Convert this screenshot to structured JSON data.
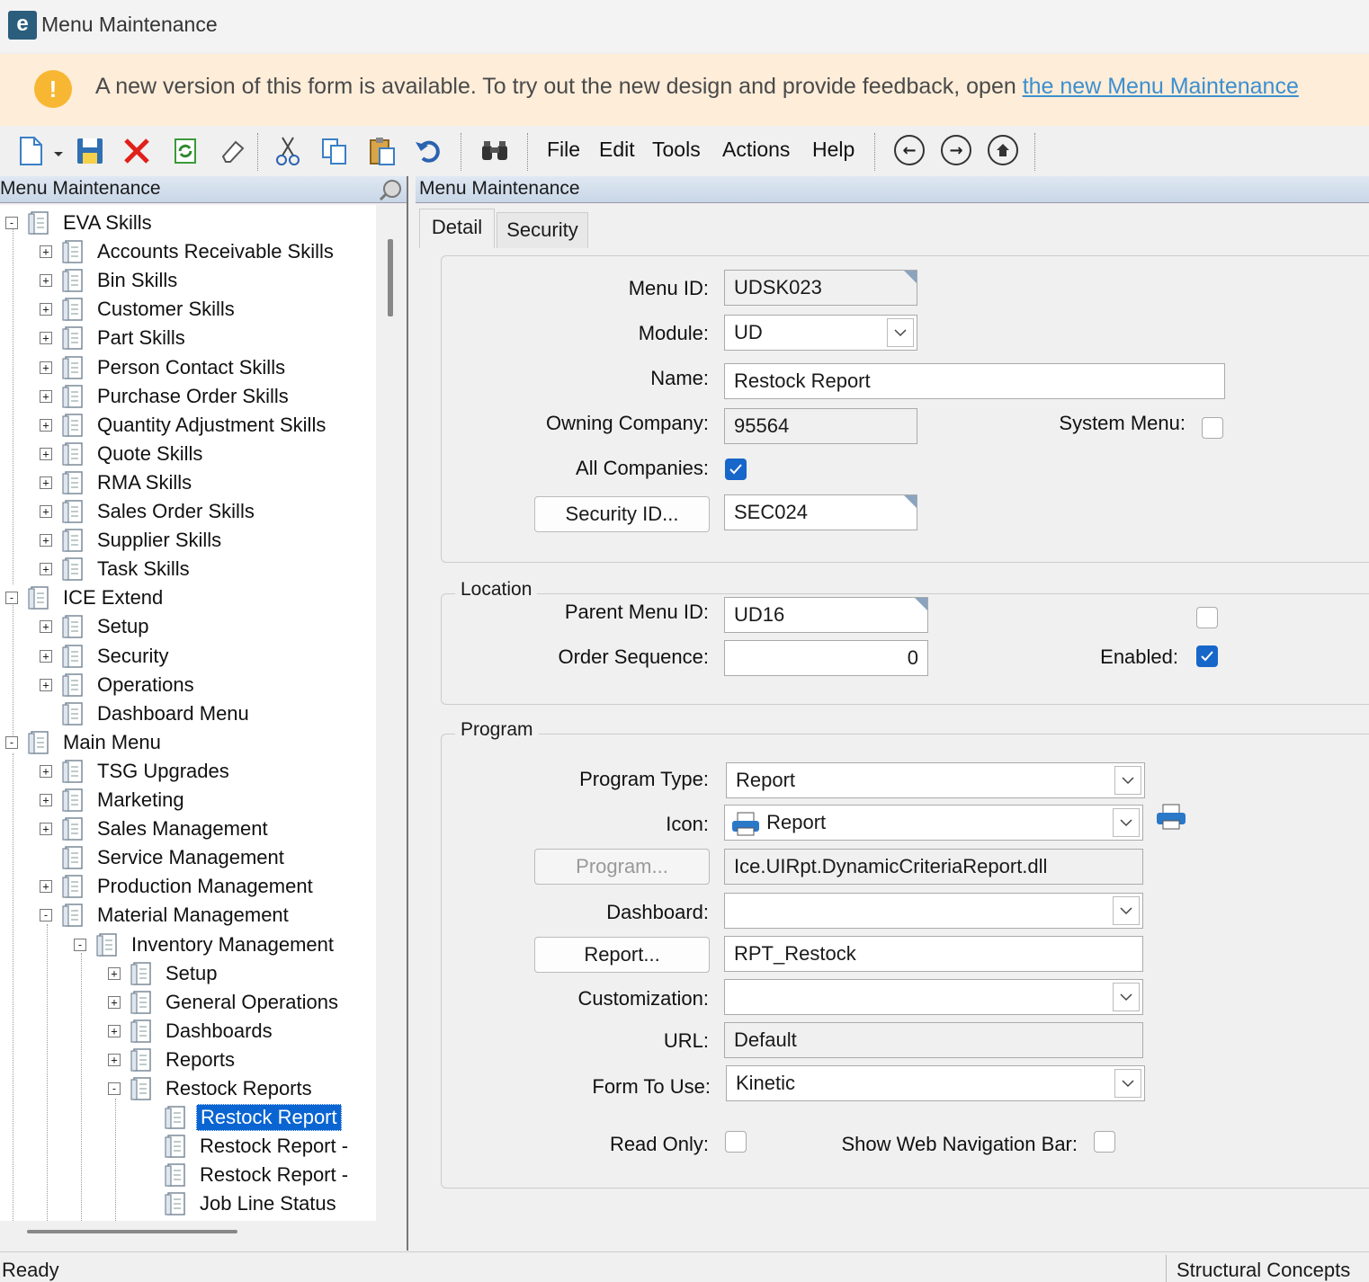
{
  "window": {
    "logo_letter": "e",
    "title": "Menu Maintenance"
  },
  "banner": {
    "icon": "!",
    "text": "A new version of this form is available. To try out the new design and provide feedback, open ",
    "link": "the new Menu Maintenance"
  },
  "toolbar": {
    "menus": [
      "File",
      "Edit",
      "Tools",
      "Actions",
      "Help"
    ]
  },
  "left_panel": {
    "title": "Menu Maintenance",
    "tree": [
      {
        "label": "EVA Skills",
        "level": 0,
        "exp": "-"
      },
      {
        "label": "Accounts Receivable Skills",
        "level": 1,
        "exp": "+"
      },
      {
        "label": "Bin Skills",
        "level": 1,
        "exp": "+"
      },
      {
        "label": "Customer Skills",
        "level": 1,
        "exp": "+"
      },
      {
        "label": "Part Skills",
        "level": 1,
        "exp": "+"
      },
      {
        "label": "Person Contact Skills",
        "level": 1,
        "exp": "+"
      },
      {
        "label": "Purchase Order Skills",
        "level": 1,
        "exp": "+"
      },
      {
        "label": "Quantity Adjustment Skills",
        "level": 1,
        "exp": "+"
      },
      {
        "label": "Quote Skills",
        "level": 1,
        "exp": "+"
      },
      {
        "label": "RMA Skills",
        "level": 1,
        "exp": "+"
      },
      {
        "label": "Sales Order Skills",
        "level": 1,
        "exp": "+"
      },
      {
        "label": "Supplier Skills",
        "level": 1,
        "exp": "+"
      },
      {
        "label": "Task Skills",
        "level": 1,
        "exp": "+"
      },
      {
        "label": "ICE Extend",
        "level": 0,
        "exp": "-"
      },
      {
        "label": "Setup",
        "level": 1,
        "exp": "+"
      },
      {
        "label": "Security",
        "level": 1,
        "exp": "+"
      },
      {
        "label": "Operations",
        "level": 1,
        "exp": "+"
      },
      {
        "label": "Dashboard Menu",
        "level": 1,
        "exp": ""
      },
      {
        "label": "Main Menu",
        "level": 0,
        "exp": "-"
      },
      {
        "label": "TSG Upgrades",
        "level": 1,
        "exp": "+"
      },
      {
        "label": "Marketing",
        "level": 1,
        "exp": "+"
      },
      {
        "label": "Sales Management",
        "level": 1,
        "exp": "+"
      },
      {
        "label": "Service Management",
        "level": 1,
        "exp": ""
      },
      {
        "label": "Production Management",
        "level": 1,
        "exp": "+"
      },
      {
        "label": "Material Management",
        "level": 1,
        "exp": "-"
      },
      {
        "label": "Inventory Management",
        "level": 2,
        "exp": "-"
      },
      {
        "label": "Setup",
        "level": 3,
        "exp": "+"
      },
      {
        "label": "General Operations",
        "level": 3,
        "exp": "+"
      },
      {
        "label": "Dashboards",
        "level": 3,
        "exp": "+"
      },
      {
        "label": "Reports",
        "level": 3,
        "exp": "+"
      },
      {
        "label": "Restock Reports",
        "level": 3,
        "exp": "-"
      },
      {
        "label": "Restock Report",
        "level": 4,
        "exp": "",
        "selected": true
      },
      {
        "label": "Restock Report -",
        "level": 4,
        "exp": ""
      },
      {
        "label": "Restock Report -",
        "level": 4,
        "exp": ""
      },
      {
        "label": "Job Line Status",
        "level": 4,
        "exp": ""
      }
    ]
  },
  "right_panel": {
    "title": "Menu Maintenance",
    "tabs": [
      "Detail",
      "Security"
    ],
    "detail": {
      "menu_id_label": "Menu ID:",
      "menu_id": "UDSK023",
      "module_label": "Module:",
      "module": "UD",
      "name_label": "Name:",
      "name": "Restock Report",
      "owning_company_label": "Owning Company:",
      "owning_company": "95564",
      "system_menu_label": "System Menu:",
      "system_menu": false,
      "all_companies_label": "All Companies:",
      "all_companies": true,
      "security_id_button": "Security ID...",
      "security_id": "SEC024"
    },
    "location": {
      "title": "Location",
      "parent_menu_label": "Parent Menu ID:",
      "parent_menu": "UD16",
      "order_seq_label": "Order Sequence:",
      "order_seq": "0",
      "unlabeled_checkbox": false,
      "enabled_label": "Enabled:",
      "enabled": true
    },
    "program": {
      "title": "Program",
      "program_type_label": "Program Type:",
      "program_type": "Report",
      "icon_label": "Icon:",
      "icon": "Report",
      "program_button": "Program...",
      "program": "Ice.UIRpt.DynamicCriteriaReport.dll",
      "dashboard_label": "Dashboard:",
      "dashboard": "",
      "report_button": "Report...",
      "report": "RPT_Restock",
      "customization_label": "Customization:",
      "customization": "",
      "url_label": "URL:",
      "url": "Default",
      "form_label": "Form To Use:",
      "form": "Kinetic",
      "read_only_label": "Read Only:",
      "read_only": false,
      "web_nav_label": "Show Web Navigation Bar:",
      "web_nav": false
    }
  },
  "status": {
    "text": "Ready",
    "company": "Structural Concepts"
  }
}
